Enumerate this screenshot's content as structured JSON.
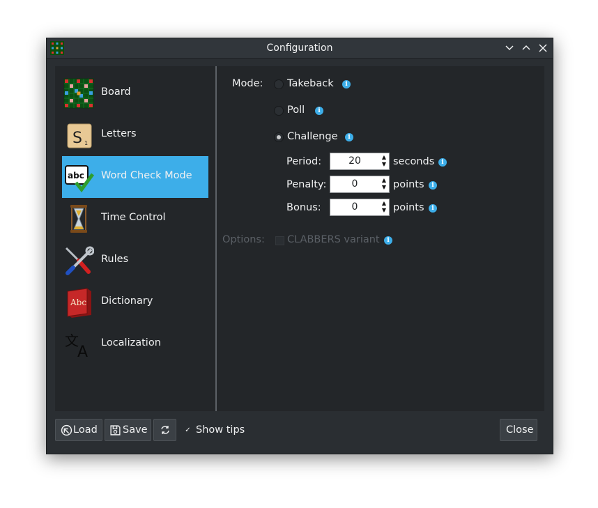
{
  "window": {
    "title": "Configuration",
    "controls": {
      "minimize": "minimize-icon",
      "maximize": "maximize-icon",
      "close": "close-icon"
    }
  },
  "sidebar": {
    "items": [
      {
        "label": "Board",
        "icon": "board-icon",
        "active": false
      },
      {
        "label": "Letters",
        "icon": "letter-tile-icon",
        "active": false
      },
      {
        "label": "Word Check Mode",
        "icon": "spellcheck-icon",
        "active": true
      },
      {
        "label": "Time Control",
        "icon": "hourglass-icon",
        "active": false
      },
      {
        "label": "Rules",
        "icon": "tools-icon",
        "active": false
      },
      {
        "label": "Dictionary",
        "icon": "dictionary-book-icon",
        "active": false
      },
      {
        "label": "Localization",
        "icon": "translate-icon",
        "active": false
      }
    ]
  },
  "mode": {
    "label": "Mode:",
    "options": [
      {
        "label": "Takeback",
        "checked": false
      },
      {
        "label": "Poll",
        "checked": false
      },
      {
        "label": "Challenge",
        "checked": true
      }
    ]
  },
  "challenge": {
    "period": {
      "label": "Period:",
      "value": "20",
      "unit": "seconds"
    },
    "penalty": {
      "label": "Penalty:",
      "value": "0",
      "unit": "points"
    },
    "bonus": {
      "label": "Bonus:",
      "value": "0",
      "unit": "points"
    }
  },
  "options": {
    "label": "Options:",
    "clabbers": {
      "label": "CLABBERS variant",
      "checked": false,
      "enabled": false
    }
  },
  "footer": {
    "load": "Load",
    "save": "Save",
    "show_tips": "Show tips",
    "show_tips_checked": true,
    "close": "Close"
  },
  "colors": {
    "accent": "#3daee9",
    "background": "#232629",
    "frame": "#2a2e32",
    "info": "#3daee9"
  }
}
